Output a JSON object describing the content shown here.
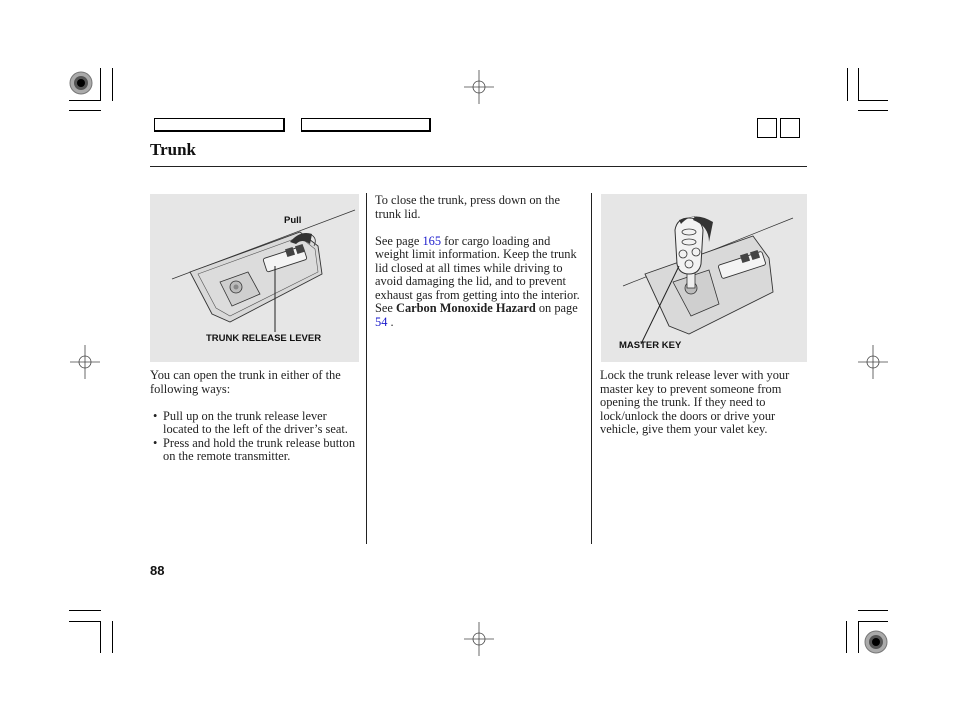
{
  "header": {
    "title": "Trunk",
    "nav_buttons": [
      "",
      ""
    ],
    "square_buttons": [
      "",
      ""
    ]
  },
  "figures": {
    "left": {
      "labels": {
        "pull": "Pull",
        "lever": "TRUNK RELEASE LEVER"
      }
    },
    "right": {
      "labels": {
        "key": "MASTER KEY"
      }
    }
  },
  "column1": {
    "intro": "You can open the trunk in either of the following ways:",
    "bullets": [
      "Pull up on the trunk release lever located to the left of the driver’s seat.",
      "Press and hold the trunk release button on the remote transmitter."
    ]
  },
  "column2": {
    "para1": "To close the trunk, press down on the trunk lid.",
    "para2_a": "See page ",
    "para2_link1": "165",
    "para2_b": " for cargo loading and weight limit information. Keep the trunk lid closed at all times while driving to avoid damaging the lid, and to prevent exhaust gas from getting into the interior. See ",
    "para2_bold": "Carbon Monoxide Hazard",
    "para2_c": " on page ",
    "para2_link2": "54",
    "para2_d": " ."
  },
  "column3": {
    "para1": "Lock the trunk release lever with your master key to prevent someone from opening the trunk. If they need to lock/unlock the doors or drive your vehicle, give them your valet key."
  },
  "footer": {
    "page_number": "88"
  },
  "colors": {
    "link": "#1a1acc",
    "figure_bg": "#e6e6e6"
  }
}
